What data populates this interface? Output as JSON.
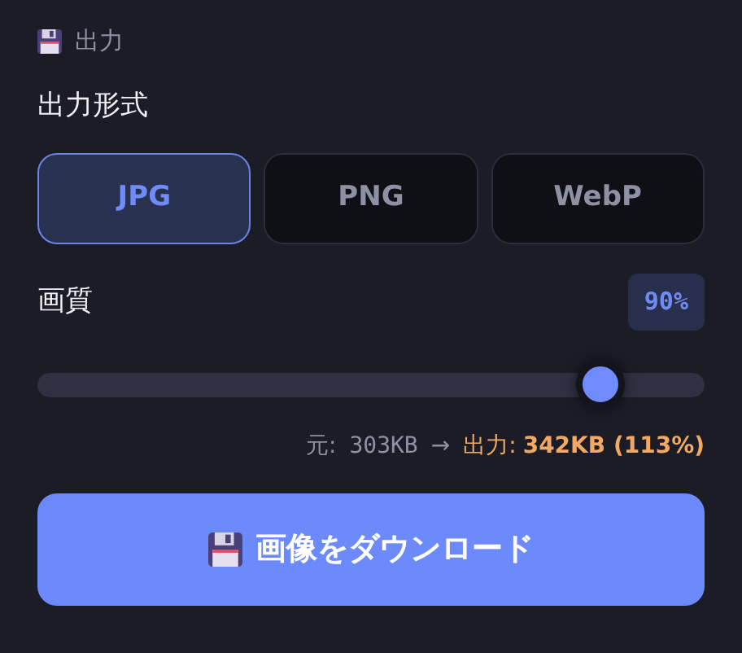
{
  "section": {
    "title": "出力"
  },
  "format": {
    "label": "出力形式",
    "options": [
      {
        "label": "JPG",
        "selected": true
      },
      {
        "label": "PNG",
        "selected": false
      },
      {
        "label": "WebP",
        "selected": false
      }
    ]
  },
  "quality": {
    "label": "画質",
    "value": "90%",
    "level": 0.87
  },
  "size_info": {
    "original_label": "元:",
    "original_size": "303KB",
    "arrow": "→",
    "output_label": "出力:",
    "output_size": "342KB (113%)"
  },
  "download_button": {
    "label": "画像をダウンロード"
  }
}
